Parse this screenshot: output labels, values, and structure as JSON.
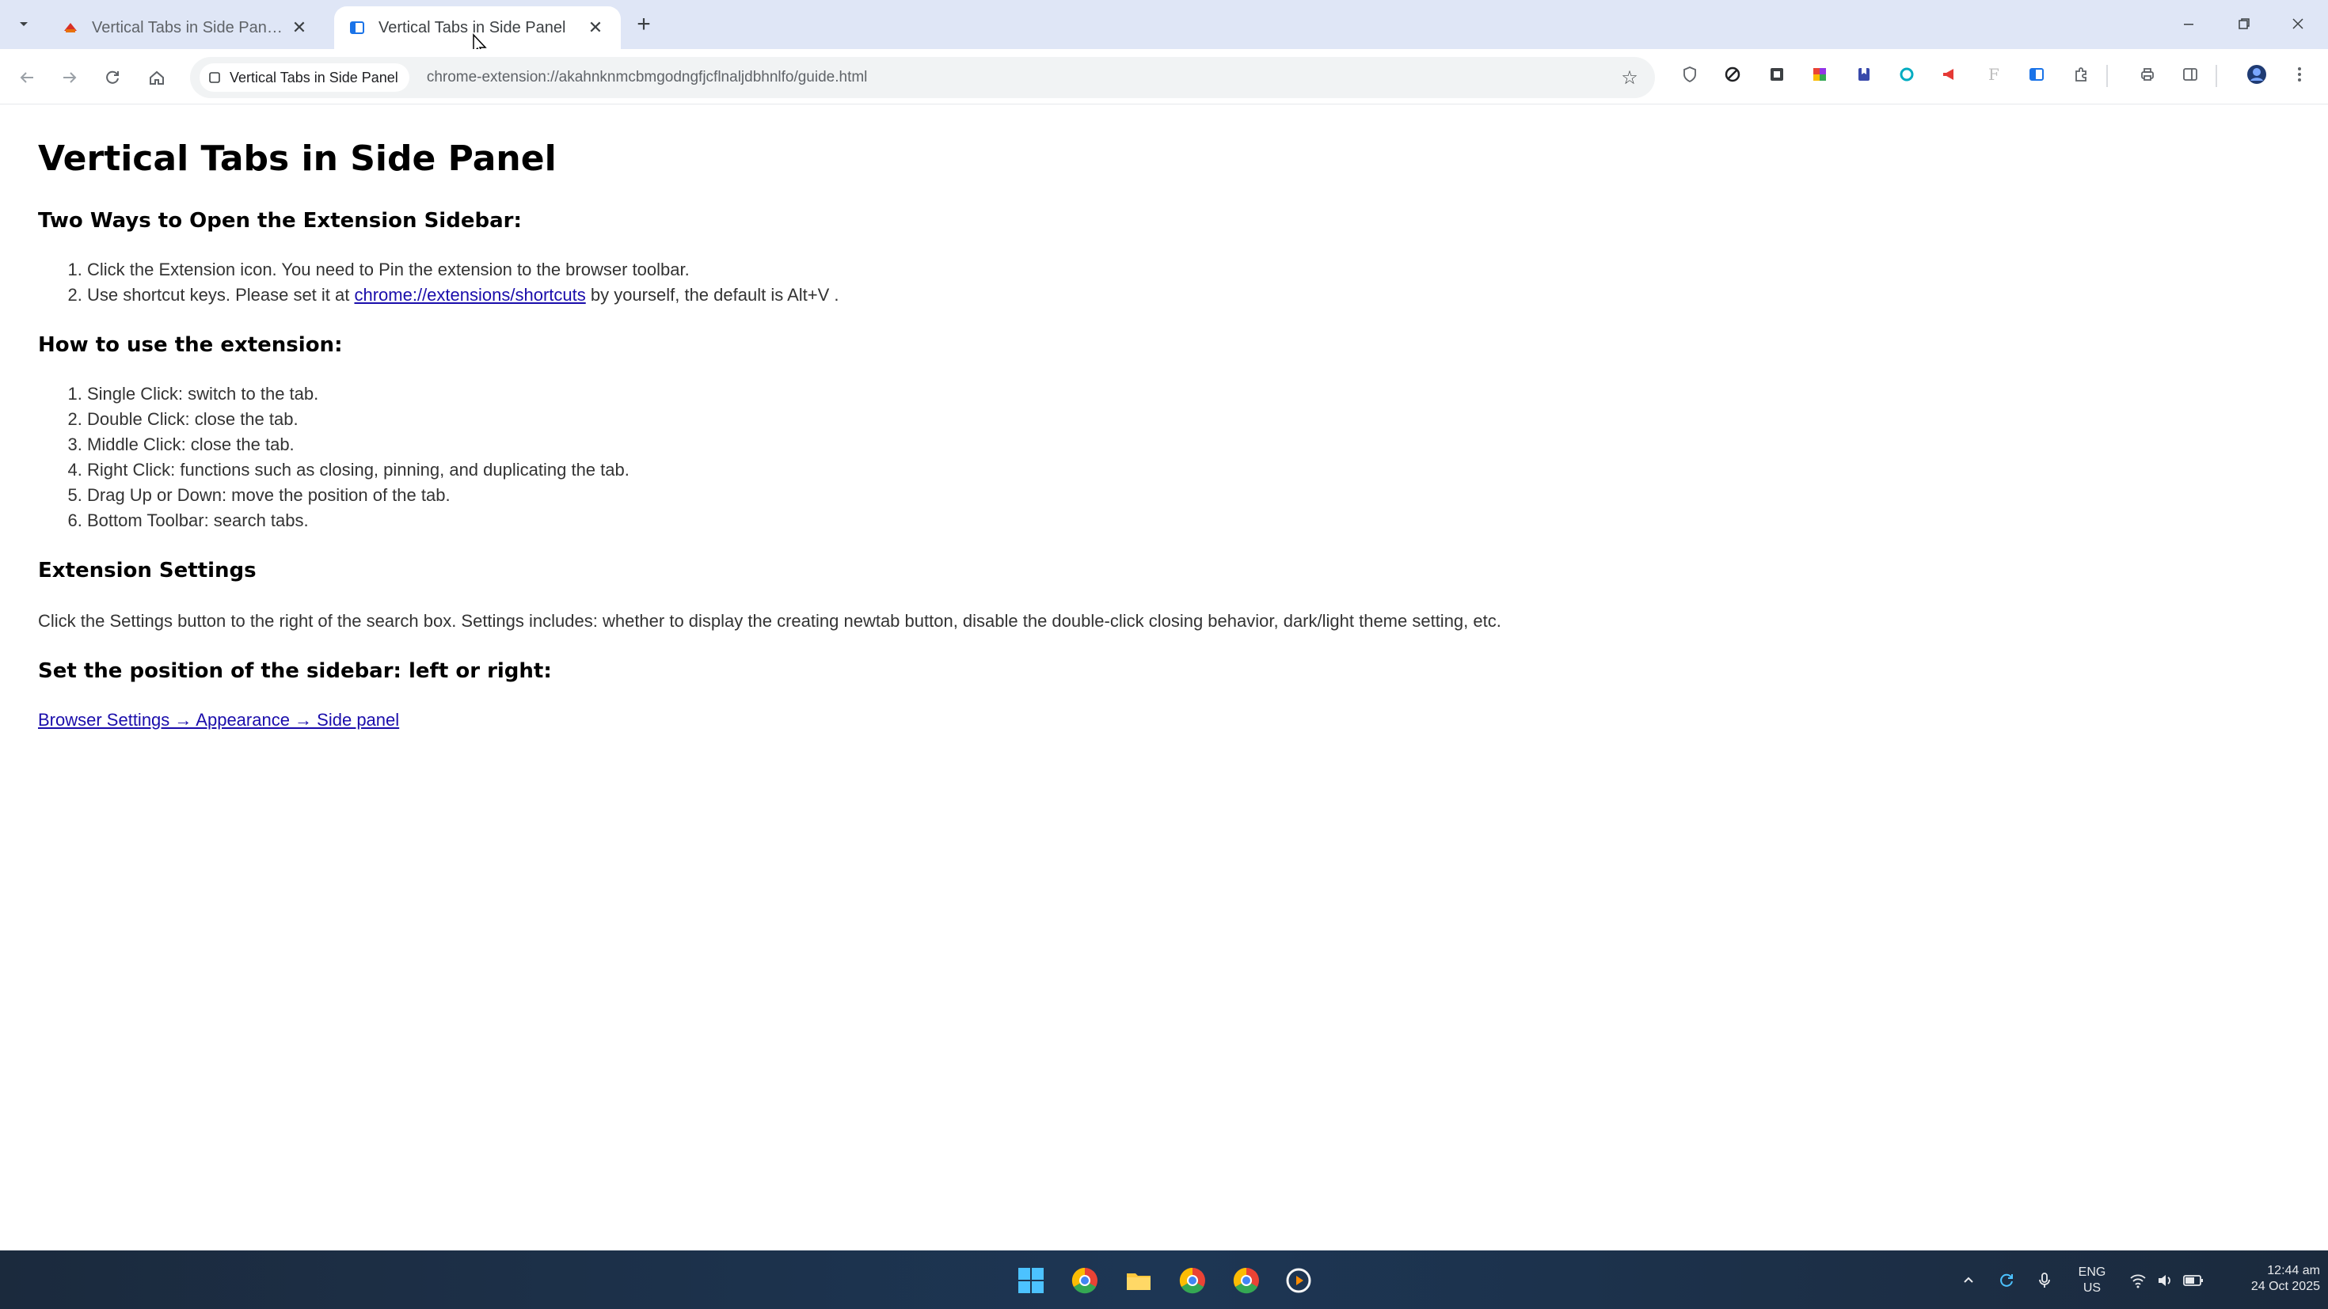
{
  "browser": {
    "tabs": [
      {
        "title": "Vertical Tabs in Side Panel - Ch",
        "active": false
      },
      {
        "title": "Vertical Tabs in Side Panel",
        "active": true
      }
    ],
    "new_tab_icon": "plus-icon",
    "tab_search_icon": "chevron-down-icon",
    "window_controls": [
      "minimize-icon",
      "restore-icon",
      "close-icon"
    ],
    "omnibox": {
      "chip_label": "Vertical Tabs in Side Panel",
      "url": "chrome-extension://akahnknmcbmgodngfjcflnaljdbhnlfo/guide.html"
    },
    "accent": "#1a73e8",
    "tabstrip_bg": "#dfe6f6"
  },
  "page": {
    "title": "Vertical Tabs in Side Panel",
    "section1": {
      "heading": "Two Ways to Open the Extension Sidebar:",
      "item1": "Click the Extension icon. You need to Pin the extension to the browser toolbar.",
      "item2_prefix": "Use shortcut keys. Please set it at ",
      "item2_link": "chrome://extensions/shortcuts",
      "item2_suffix": " by yourself, the default is Alt+V ."
    },
    "section2": {
      "heading": "How to use the extension:",
      "items": [
        "Single Click: switch to the tab.",
        "Double Click: close the tab.",
        "Middle Click: close the tab.",
        "Right Click: functions such as closing, pinning, and duplicating the tab.",
        "Drag Up or Down: move the position of the tab.",
        "Bottom Toolbar: search tabs."
      ]
    },
    "section3": {
      "heading": "Extension Settings",
      "body": "Click the Settings button to the right of the search box. Settings includes: whether to display the creating newtab button, disable the double-click closing behavior, dark/light theme setting, etc."
    },
    "section4": {
      "heading": "Set the position of the sidebar: left or right:",
      "link": "Browser Settings → Appearance → Side panel"
    },
    "link_color": "#1a0dab"
  },
  "taskbar": {
    "tray": {
      "lang_line1": "ENG",
      "lang_line2": "US",
      "time": "12:44 am",
      "date": "24 Oct 2025"
    },
    "bg": "#1d3654"
  }
}
